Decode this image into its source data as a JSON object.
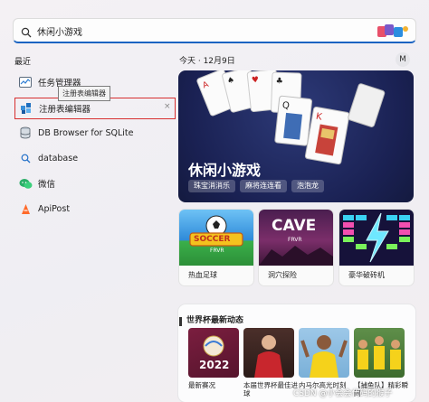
{
  "search": {
    "value": "休闲小游戏",
    "placeholder": ""
  },
  "recent": {
    "title": "最近",
    "items": [
      {
        "label": "任务管理器",
        "icon": "task-manager-icon"
      },
      {
        "label": "注册表编辑器",
        "icon": "registry-editor-icon"
      },
      {
        "label": "DB Browser for SQLite",
        "icon": "database-icon"
      },
      {
        "label": "database",
        "icon": "search-icon"
      },
      {
        "label": "微信",
        "icon": "wechat-icon"
      },
      {
        "label": "ApiPost",
        "icon": "apipost-icon"
      }
    ],
    "tooltip": "注册表编辑器",
    "close": "×"
  },
  "header": {
    "date": "今天 · 12月9日",
    "avatar": "M"
  },
  "hero": {
    "title": "休闲小游戏",
    "chips": [
      "珠宝消消乐",
      "麻将连连看",
      "泡泡龙"
    ]
  },
  "games": [
    {
      "label": "热血足球",
      "art_text": "SOCCER",
      "art_sub": "FRVR"
    },
    {
      "label": "洞穴探险",
      "art_text": "CAVE",
      "art_sub": "FRVR"
    },
    {
      "label": "豪华破砖机",
      "art_text": "",
      "art_sub": ""
    }
  ],
  "news": {
    "title": "世界杯最新动态",
    "items": [
      {
        "caption": "最新赛况",
        "art_text": "2022"
      },
      {
        "caption": "本届世界杯最佳进球",
        "art_text": ""
      },
      {
        "caption": "内马尔高光时刻",
        "art_text": ""
      },
      {
        "caption": "【捕鱼队】精彩瞬间",
        "art_text": ""
      }
    ]
  },
  "watermark": "CSDN @小会会代码的猴子",
  "colors": {
    "accent": "#1a63c2",
    "highlight_border": "#d72f2f",
    "hero_bg": "#1a2153"
  }
}
